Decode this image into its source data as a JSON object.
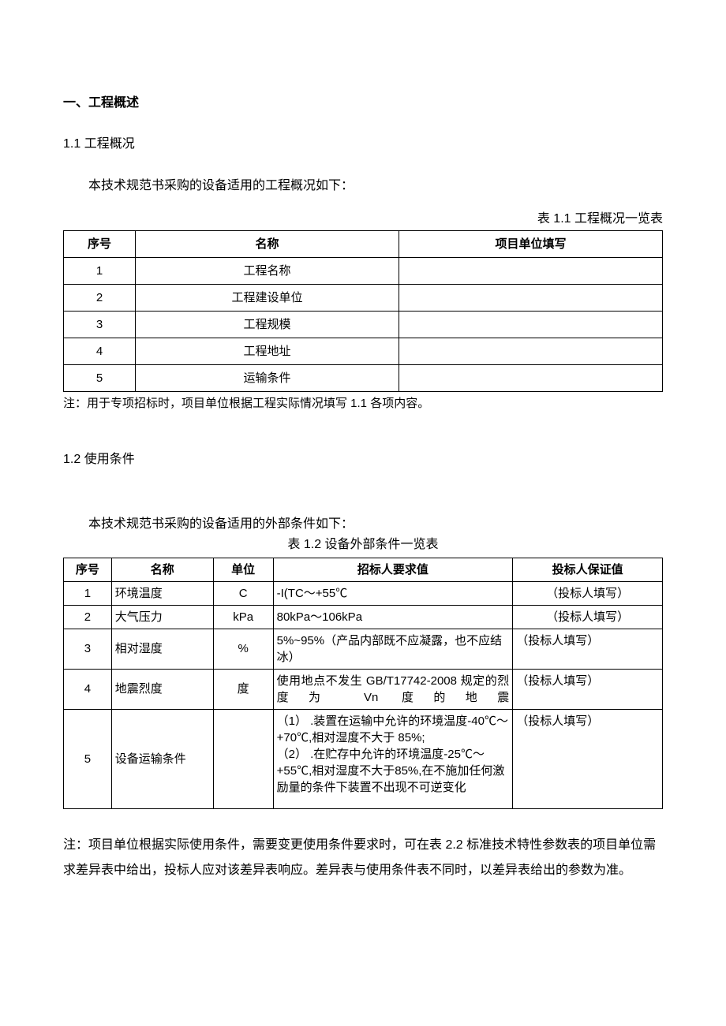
{
  "section1": {
    "title": "一、工程概述",
    "sub1": {
      "heading": "1.1 工程概况",
      "para": "本技术规范书采购的设备适用的工程概况如下：",
      "caption": "表 1.1 工程概况一览表",
      "headers": {
        "seq": "序号",
        "name": "名称",
        "fill": "项目单位填写"
      },
      "rows": [
        {
          "seq": "1",
          "name": "工程名称",
          "fill": ""
        },
        {
          "seq": "2",
          "name": "工程建设单位",
          "fill": ""
        },
        {
          "seq": "3",
          "name": "工程规模",
          "fill": ""
        },
        {
          "seq": "4",
          "name": "工程地址",
          "fill": ""
        },
        {
          "seq": "5",
          "name": "运输条件",
          "fill": ""
        }
      ],
      "note": "注：用于专项招标时，项目单位根据工程实际情况填写 1.1 各项内容。"
    },
    "sub2": {
      "heading": "1.2 使用条件",
      "para": "本技术规范书采购的设备适用的外部条件如下：",
      "caption": "表 1.2 设备外部条件一览表",
      "headers": {
        "seq": "序号",
        "name": "名称",
        "unit": "单位",
        "req": "招标人要求值",
        "bid": "投标人保证值"
      },
      "rows": [
        {
          "seq": "1",
          "name": "环境温度",
          "unit": "C",
          "req": "-I(TC～+55℃",
          "bid": "（投标人填写）"
        },
        {
          "seq": "2",
          "name": "大气压力",
          "unit": "kPa",
          "req": "80kPa～106kPa",
          "bid": "（投标人填写）"
        },
        {
          "seq": "3",
          "name": "相对湿度",
          "unit": "%",
          "req": "5%~95%（产品内部既不应凝露，也不应结冰）",
          "bid": "（投标人填写）"
        },
        {
          "seq": "4",
          "name": "地震烈度",
          "unit": "度",
          "req": "使用地点不发生 GB/T17742-2008 规定的烈度为 Vn 度的地震",
          "bid": "（投标人填写）"
        },
        {
          "seq": "5",
          "name": "设备运输条件",
          "unit": "",
          "req": "（1） .装置在运输中允许的环境温度-40℃～+70℃,相对湿度不大于 85%;\n（2） .在贮存中允许的环境温度-25℃～+55℃,相对湿度不大于85%,在不施加任何激励量的条件下装置不出现不可逆变化",
          "bid": "（投标人填写）"
        }
      ],
      "note": "注：项目单位根据实际使用条件，需要变更使用条件要求时，可在表 2.2 标准技术特性参数表的项目单位需求差异表中给出，投标人应对该差异表响应。差异表与使用条件表不同时，以差异表给出的参数为准。"
    }
  }
}
